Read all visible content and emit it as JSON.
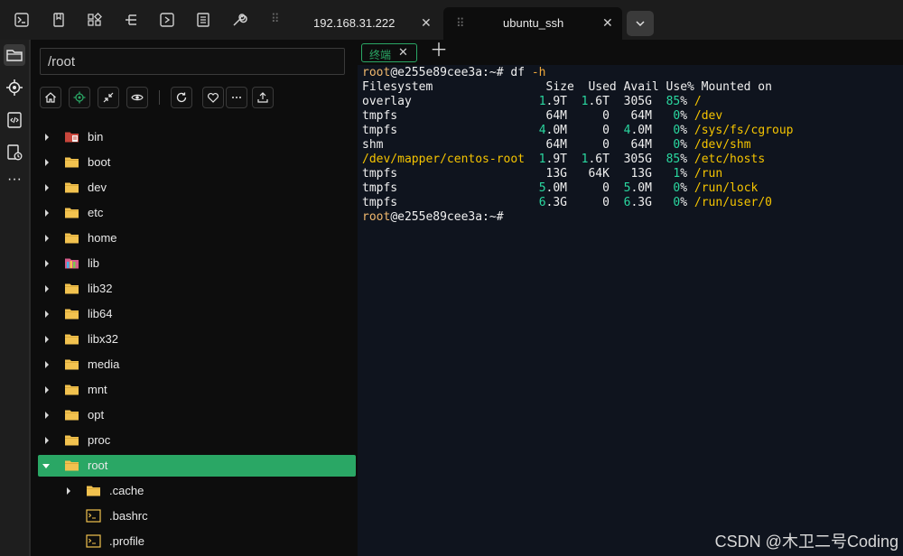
{
  "tabs": [
    {
      "label": "192.168.31.222"
    },
    {
      "label": "ubuntu_ssh"
    }
  ],
  "file_panel": {
    "path": "/root",
    "tree": [
      {
        "name": "bin",
        "type": "special"
      },
      {
        "name": "boot",
        "type": "folder"
      },
      {
        "name": "dev",
        "type": "folder"
      },
      {
        "name": "etc",
        "type": "folder"
      },
      {
        "name": "home",
        "type": "folder"
      },
      {
        "name": "lib",
        "type": "special"
      },
      {
        "name": "lib32",
        "type": "folder"
      },
      {
        "name": "lib64",
        "type": "folder"
      },
      {
        "name": "libx32",
        "type": "folder"
      },
      {
        "name": "media",
        "type": "folder"
      },
      {
        "name": "mnt",
        "type": "folder"
      },
      {
        "name": "opt",
        "type": "folder"
      },
      {
        "name": "proc",
        "type": "folder"
      },
      {
        "name": "root",
        "type": "folder",
        "expanded": true,
        "selected": true
      },
      {
        "name": ".cache",
        "type": "folder",
        "child": true
      },
      {
        "name": ".bashrc",
        "type": "file",
        "child": true
      },
      {
        "name": ".profile",
        "type": "file",
        "child": true
      }
    ]
  },
  "terminal": {
    "tab_label": "终端",
    "prompt_host": "root",
    "prompt_rest": "@e255e89cee3a:~#",
    "command": "df",
    "command_option": "-h",
    "header": "Filesystem                Size  Used Avail Use% Mounted on",
    "rows": [
      {
        "fs": "overlay",
        "size": "1.9T",
        "used": "1.6T",
        "avail": "305G",
        "use": "85%",
        "mount": "/"
      },
      {
        "fs": "tmpfs",
        "size": "64M",
        "used": "0",
        "avail": "64M",
        "use": "0%",
        "mount": "/dev"
      },
      {
        "fs": "tmpfs",
        "size": "4.0M",
        "used": "0",
        "avail": "4.0M",
        "use": "0%",
        "mount": "/sys/fs/cgroup"
      },
      {
        "fs": "shm",
        "size": "64M",
        "used": "0",
        "avail": "64M",
        "use": "0%",
        "mount": "/dev/shm"
      },
      {
        "fs": "/dev/mapper/centos-root",
        "size": "1.9T",
        "used": "1.6T",
        "avail": "305G",
        "use": "85%",
        "mount": "/etc/hosts"
      },
      {
        "fs": "tmpfs",
        "size": "13G",
        "used": "64K",
        "avail": "13G",
        "use": "1%",
        "mount": "/run"
      },
      {
        "fs": "tmpfs",
        "size": "5.0M",
        "used": "0",
        "avail": "5.0M",
        "use": "0%",
        "mount": "/run/lock"
      },
      {
        "fs": "tmpfs",
        "size": "6.3G",
        "used": "0",
        "avail": "6.3G",
        "use": "0%",
        "mount": "/run/user/0"
      }
    ]
  },
  "watermark": "CSDN @木卫二号Coding",
  "icons": {
    "activity": [
      "folder-icon",
      "locate-icon",
      "code-icon",
      "file-history-icon",
      "more-icon"
    ],
    "toolbar": [
      "home-icon",
      "locate-icon",
      "collapse-icon",
      "eye-icon",
      "refresh-icon",
      "heart-icon",
      "more-icon",
      "upload-icon"
    ]
  },
  "colors": {
    "accent": "#2aa765",
    "folder": "#f2c24f",
    "prompt": "#f0b86e",
    "number": "#2ad8a0",
    "mount": "#f5c400",
    "terminal_bg": "#0f141e"
  }
}
